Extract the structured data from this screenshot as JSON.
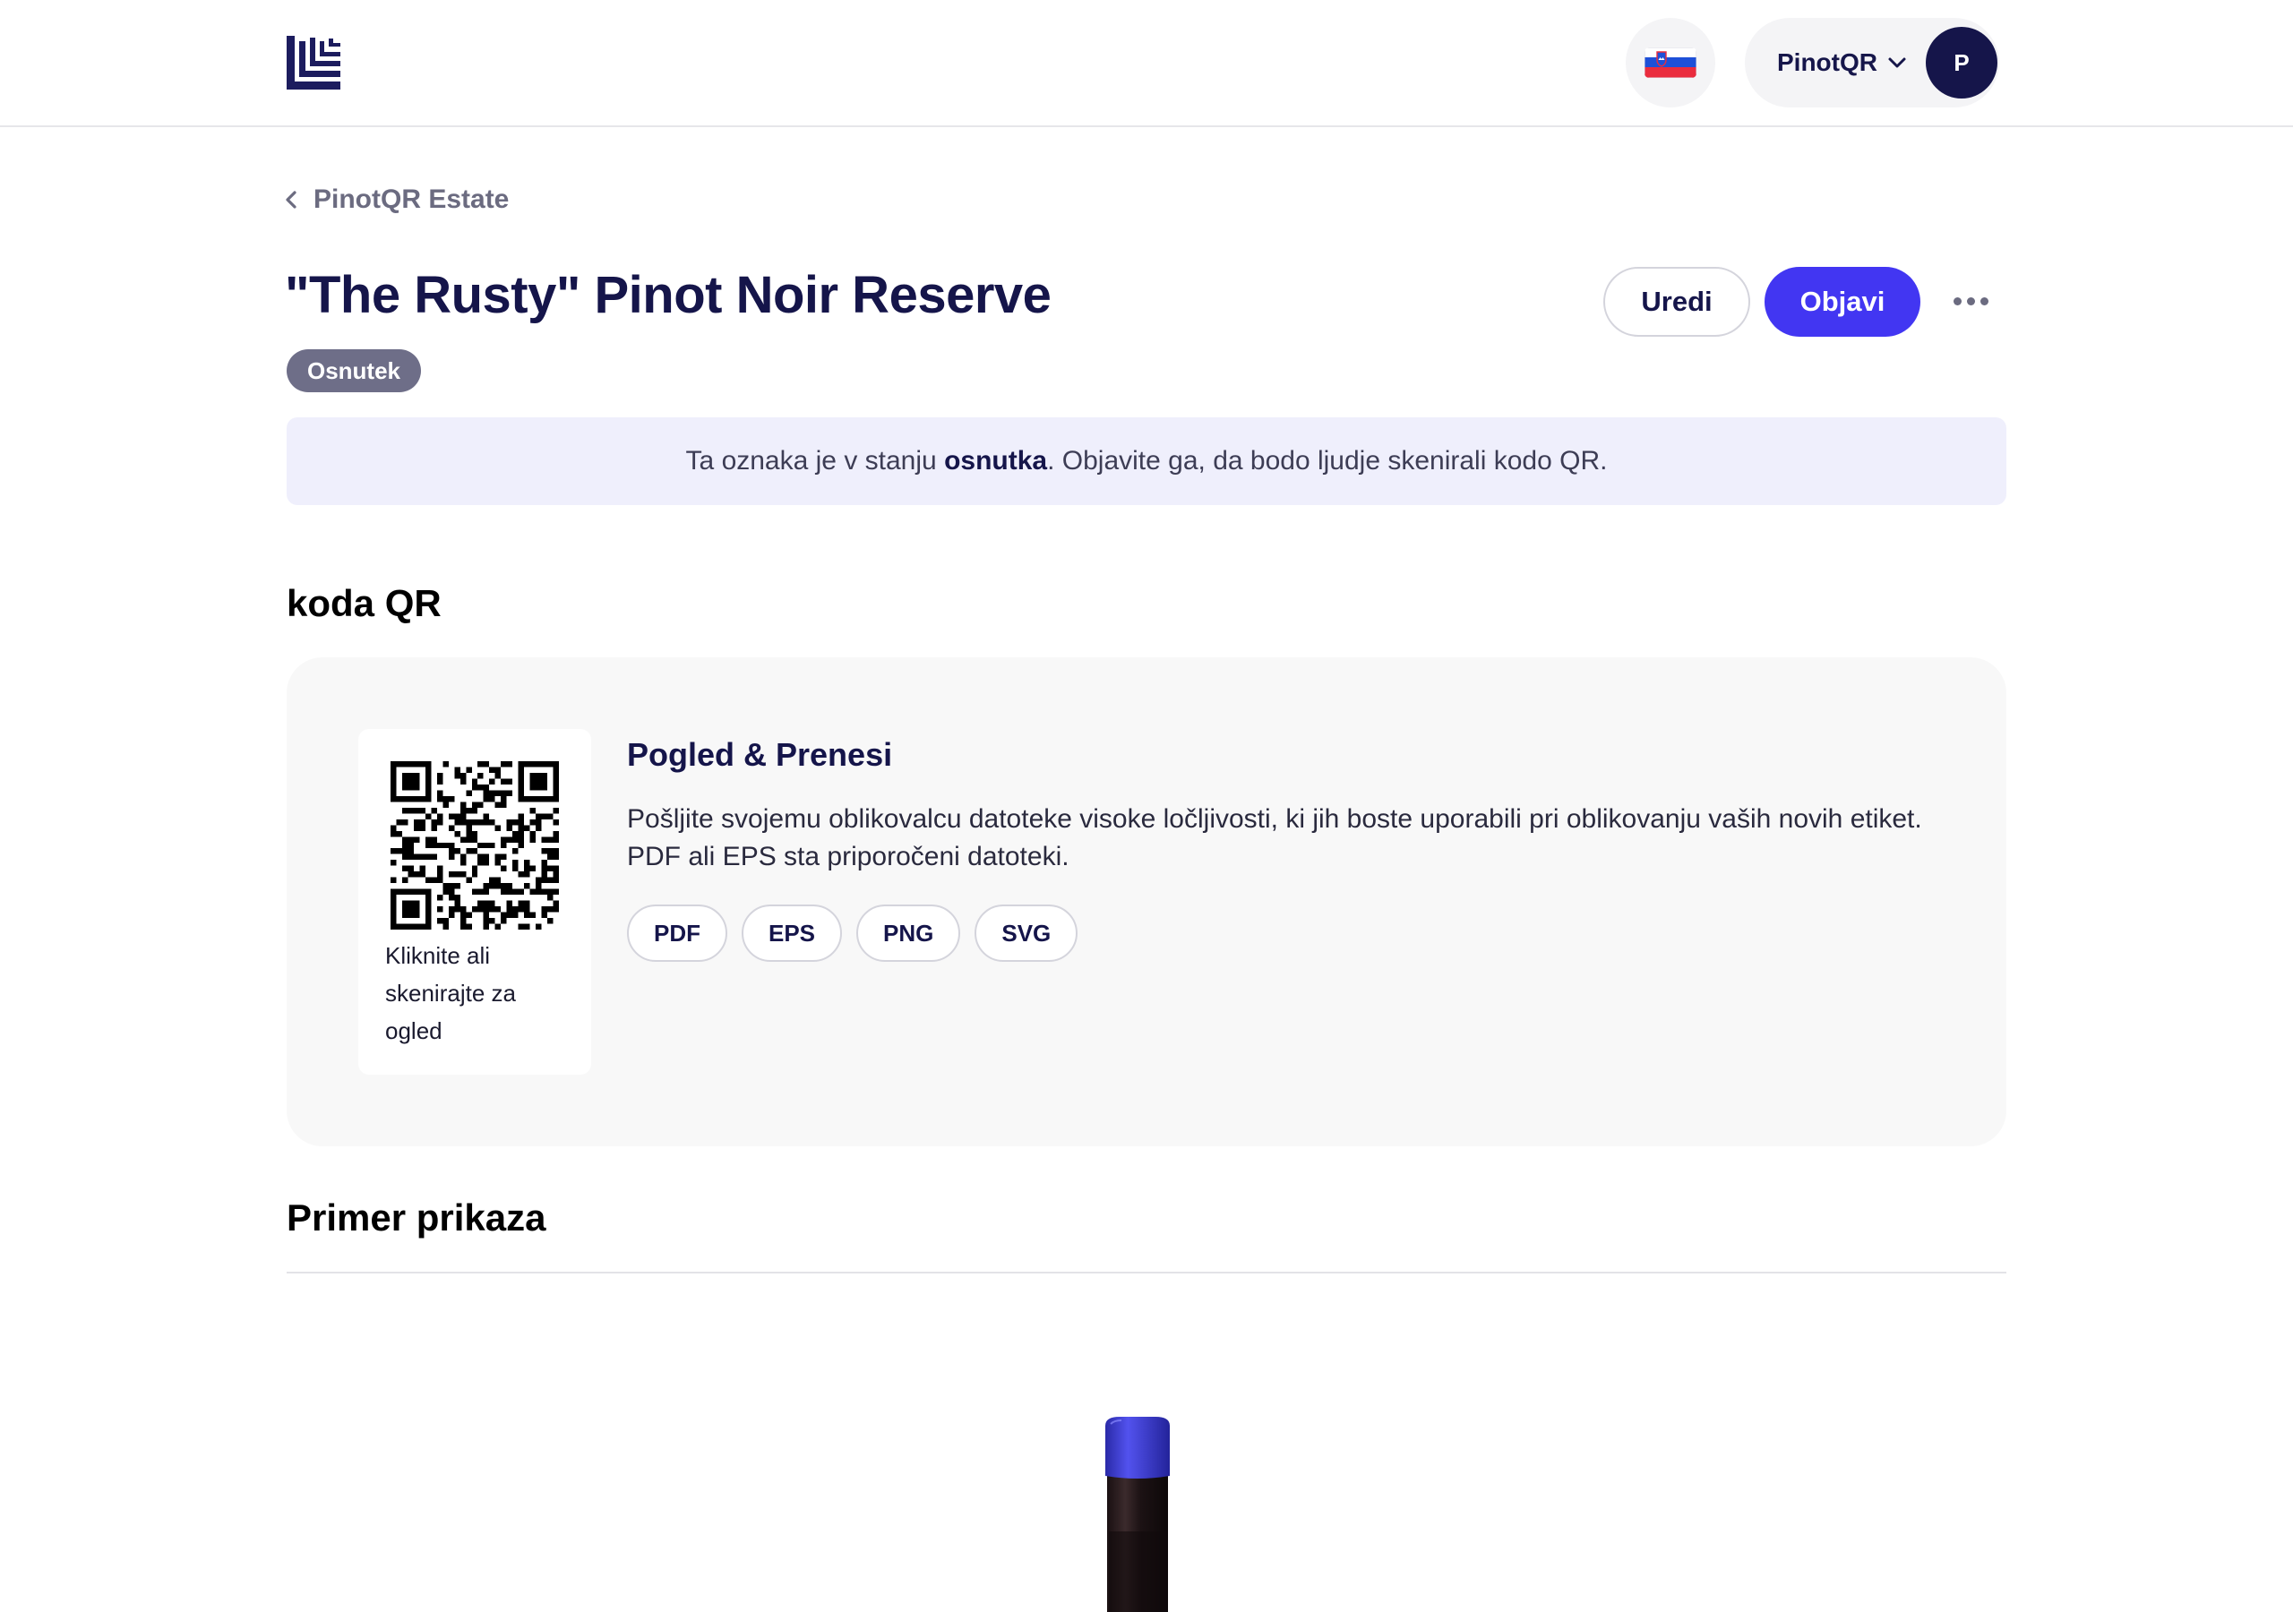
{
  "header": {
    "logo_icon": "stacked-lines-logo",
    "flag_icon": "flag-si-icon",
    "account_name": "PinotQR",
    "avatar_initial": "P"
  },
  "breadcrumb": {
    "label": "PinotQR Estate"
  },
  "page": {
    "title": "\"The Rusty\" Pinot Noir Reserve",
    "status_badge": "Osnutek",
    "edit_label": "Uredi",
    "publish_label": "Objavi"
  },
  "notice": {
    "before": "Ta oznaka je v stanju ",
    "bold": "osnutka",
    "after": ". Objavite ga, da bodo ljudje skenirali kodo QR."
  },
  "qr_section": {
    "title": "koda QR",
    "tile_caption": "Kliknite ali skenirajte za ogled",
    "download_title": "Pogled & Prenesi",
    "download_description": "Pošljite svojemu oblikovalcu datoteke visoke ločljivosti, ki jih boste uporabili pri oblikovanju vaših novih etiket. PDF ali EPS sta priporočeni datoteki.",
    "formats": [
      "PDF",
      "EPS",
      "PNG",
      "SVG"
    ]
  },
  "preview_section": {
    "title": "Primer prikaza"
  },
  "colors": {
    "primary": "#4236f2",
    "navy": "#15154a",
    "badge": "#6e6e88",
    "notice_bg": "#efeffc",
    "card_bg": "#f8f8f8",
    "capsule": "#3a3ad0"
  }
}
